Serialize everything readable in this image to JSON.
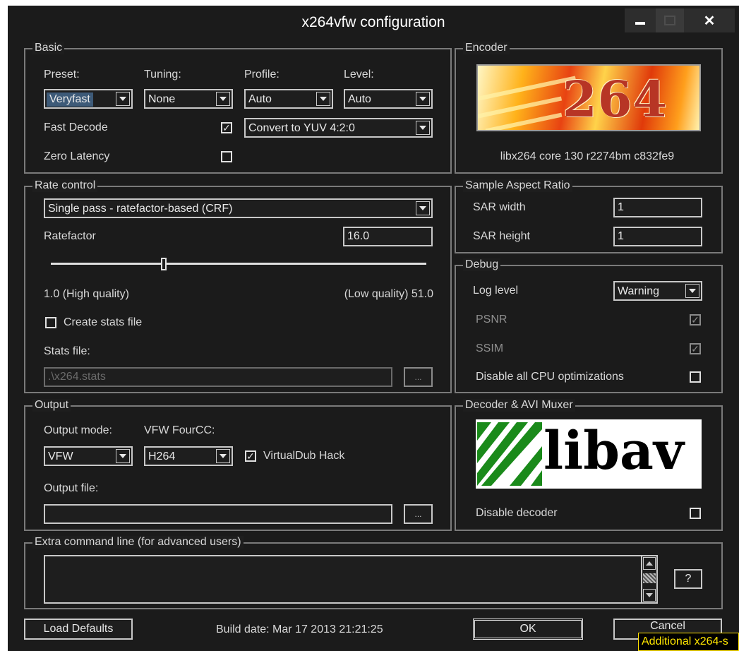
{
  "window": {
    "title": "x264vfw configuration"
  },
  "basic": {
    "group_label": "Basic",
    "preset": {
      "label": "Preset:",
      "value": "Veryfast"
    },
    "tuning": {
      "label": "Tuning:",
      "value": "None"
    },
    "profile": {
      "label": "Profile:",
      "value": "Auto"
    },
    "level": {
      "label": "Level:",
      "value": "Auto"
    },
    "fast_decode": {
      "label": "Fast Decode",
      "checked": true
    },
    "colorspace": {
      "value": "Convert to YUV 4:2:0"
    },
    "zero_latency": {
      "label": "Zero Latency",
      "checked": false
    }
  },
  "encoder": {
    "group_label": "Encoder",
    "logo_text": "264",
    "version": "libx264 core 130 r2274bm c832fe9"
  },
  "rate_control": {
    "group_label": "Rate control",
    "mode": "Single pass - ratefactor-based (CRF)",
    "ratefactor_label": "Ratefactor",
    "ratefactor_value": "16.0",
    "slider_fraction": 0.3,
    "min_label": "1.0 (High quality)",
    "max_label": "(Low quality) 51.0",
    "create_stats": {
      "label": "Create stats file",
      "checked": false
    },
    "stats_file_label": "Stats file:",
    "stats_file_value": ".\\x264.stats",
    "browse": "..."
  },
  "sar": {
    "group_label": "Sample Aspect Ratio",
    "width_label": "SAR width",
    "width_value": "1",
    "height_label": "SAR height",
    "height_value": "1"
  },
  "debug": {
    "group_label": "Debug",
    "log_level_label": "Log level",
    "log_level_value": "Warning",
    "psnr": {
      "label": "PSNR",
      "checked": true
    },
    "ssim": {
      "label": "SSIM",
      "checked": true
    },
    "disable_cpu": {
      "label": "Disable all CPU optimizations",
      "checked": false
    }
  },
  "output": {
    "group_label": "Output",
    "mode_label": "Output mode:",
    "mode_value": "VFW",
    "fourcc_label": "VFW FourCC:",
    "fourcc_value": "H264",
    "vdub_hack": {
      "label": "VirtualDub Hack",
      "checked": true
    },
    "file_label": "Output file:",
    "file_value": "",
    "browse": "..."
  },
  "decoder": {
    "group_label": "Decoder & AVI Muxer",
    "logo_text": "libav",
    "disable": {
      "label": "Disable decoder",
      "checked": false
    }
  },
  "extra": {
    "group_label": "Extra command line (for advanced users)",
    "value": "",
    "help": "?"
  },
  "footer": {
    "load_defaults": "Load Defaults",
    "build_date": "Build date: Mar 17 2013 21:21:25",
    "ok": "OK",
    "cancel": "Cancel",
    "tooltip": "Additional x264-s"
  },
  "check_mark": "✓"
}
